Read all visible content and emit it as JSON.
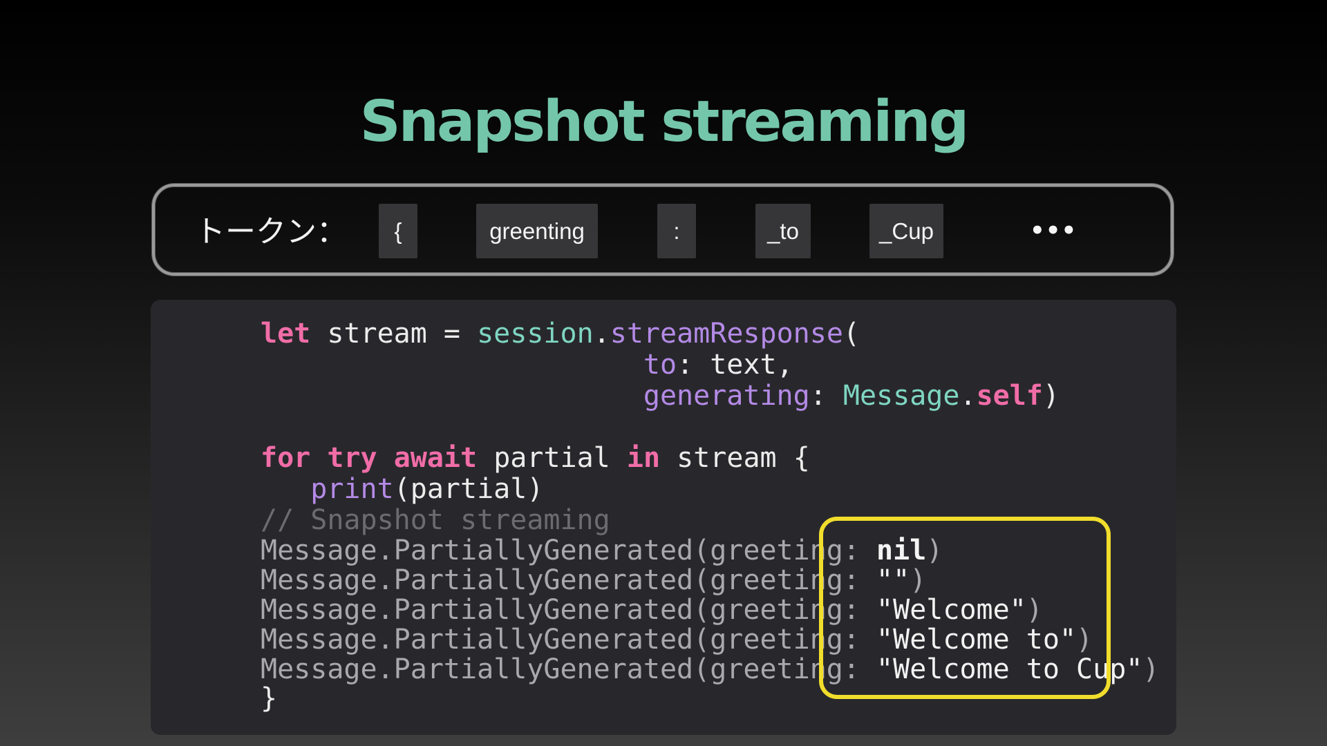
{
  "title": "Snapshot streaming",
  "tokens": {
    "label": "トークン：",
    "items": [
      "{",
      "greenting",
      ":",
      "_to",
      "_Cup"
    ],
    "more": "•••"
  },
  "code": {
    "line1": {
      "kw_let": "let",
      "name": " stream = ",
      "obj": "session",
      "dot": ".",
      "method": "streamResponse",
      "paren": "("
    },
    "line2": {
      "indent": "                       ",
      "param": "to",
      "rest": ": text,"
    },
    "line3": {
      "indent": "                       ",
      "param": "generating",
      "colon": ": ",
      "type": "Message",
      "dot": ".",
      "kw_self": "self",
      "close": ")"
    },
    "line4": {
      "kw_for": "for",
      "sp1": " ",
      "kw_try": "try",
      "sp2": " ",
      "kw_await": "await",
      "mid": " partial ",
      "kw_in": "in",
      "rest": " stream {"
    },
    "line5": {
      "indent": "   ",
      "fn": "print",
      "rest": "(partial)"
    },
    "comment": "// Snapshot streaming",
    "output_prefix": "Message.PartiallyGenerated(greeting: ",
    "outputs": [
      {
        "value": "nil",
        "close": ")"
      },
      {
        "value": "\"\"",
        "close": ")"
      },
      {
        "value": "\"Welcome\"",
        "close": ")"
      },
      {
        "value": "\"Welcome to\"",
        "close": ")"
      },
      {
        "value": "\"Welcome to Cup\"",
        "close": ")"
      }
    ],
    "closing_brace": "}"
  },
  "colors": {
    "title": "#74c6aa",
    "keyword": "#f16da8",
    "type": "#7fd6c2",
    "function": "#b48ae6",
    "comment": "#6c6c70",
    "highlight_border": "#f1dd2c",
    "panel_bg": "#28282c",
    "token_chip_bg": "#363638"
  }
}
